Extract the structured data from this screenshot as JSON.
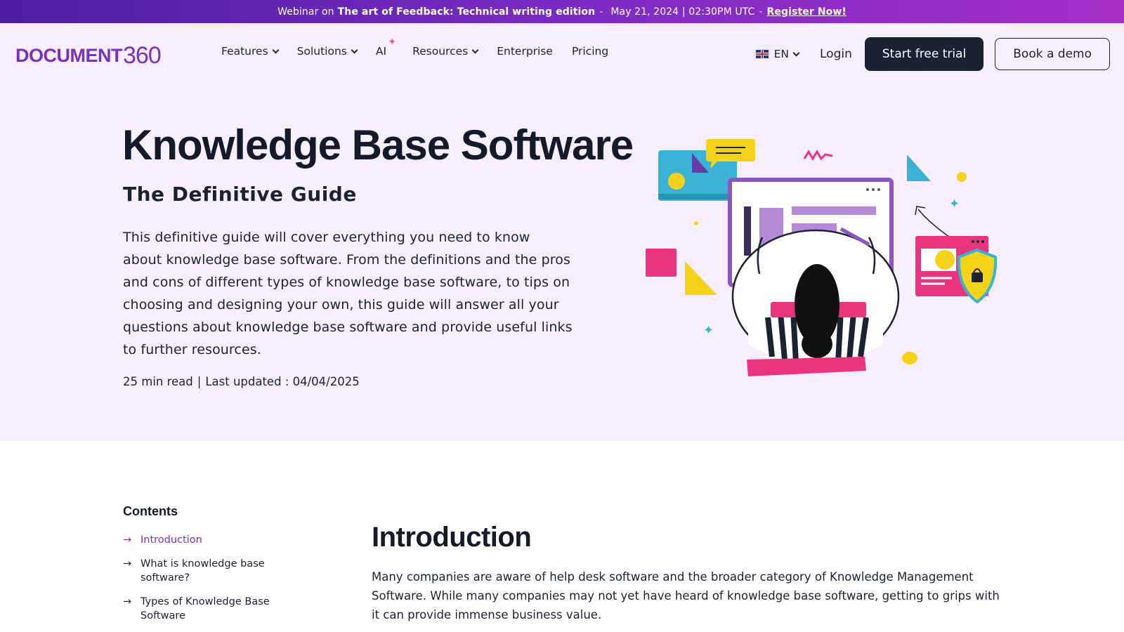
{
  "banner": {
    "prefix": "Webinar on",
    "title": "The art of Feedback: Technical writing edition",
    "dash1": "-",
    "date": "May 21, 2024 | 02:30PM UTC",
    "dash2": "-",
    "cta": "Register Now!"
  },
  "logo": {
    "text": "DOCUMENT",
    "num": "360"
  },
  "nav": {
    "items": [
      {
        "label": "Features",
        "dropdown": true
      },
      {
        "label": "Solutions",
        "dropdown": true
      },
      {
        "label": "AI",
        "dropdown": false
      },
      {
        "label": "Resources",
        "dropdown": true
      },
      {
        "label": "Enterprise",
        "dropdown": false
      },
      {
        "label": "Pricing",
        "dropdown": false
      }
    ],
    "language": "EN",
    "login": "Login",
    "trial": "Start free trial",
    "demo": "Book a demo"
  },
  "hero": {
    "title": "Knowledge Base Software",
    "subtitle": "The Definitive Guide",
    "description": "This definitive guide will cover everything you need to know about knowledge base software. From the definitions and the pros and cons of different types of knowledge base software, to tips on choosing and designing your own, this guide will answer all your questions about knowledge base software and provide useful links to further resources.",
    "read_time": "25 min read",
    "separator": "|",
    "updated": "Last updated : 04/04/2025"
  },
  "contents": {
    "title": "Contents",
    "items": [
      {
        "label": "Introduction",
        "active": true
      },
      {
        "label": "What is knowledge base software?",
        "active": false
      },
      {
        "label": "Types of Knowledge Base Software",
        "active": false
      }
    ]
  },
  "main": {
    "title": "Introduction",
    "paragraph": "Many companies are aware of help desk software and the broader category of Knowledge Management Software. While many companies may not yet have heard of knowledge base software, getting to grips with it can provide immense business value."
  },
  "colors": {
    "brand": "#7b2fc0",
    "dark": "#1b2232",
    "hero_bg": "#f7efff"
  }
}
